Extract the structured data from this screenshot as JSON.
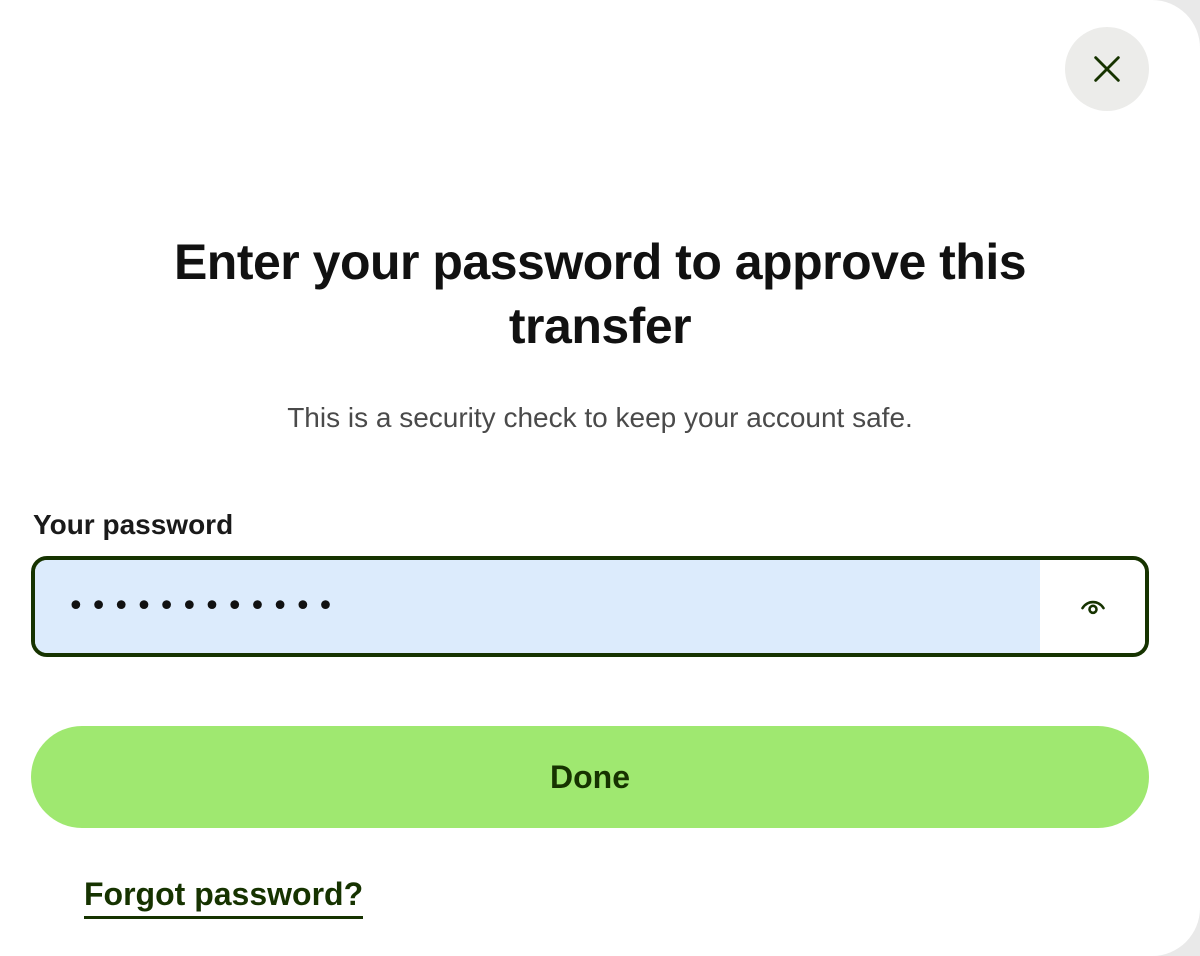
{
  "dialog": {
    "title": "Enter your password to approve this transfer",
    "subtitle": "This is a security check to keep your account safe.",
    "close_icon": "close-icon"
  },
  "password_field": {
    "label": "Your password",
    "value": "••••••••••••",
    "toggle_icon": "eye-icon"
  },
  "actions": {
    "done_label": "Done",
    "forgot_label": "Forgot password?"
  },
  "colors": {
    "accent": "#9fe870",
    "forest": "#163300",
    "input_fill": "#dcebfc"
  }
}
